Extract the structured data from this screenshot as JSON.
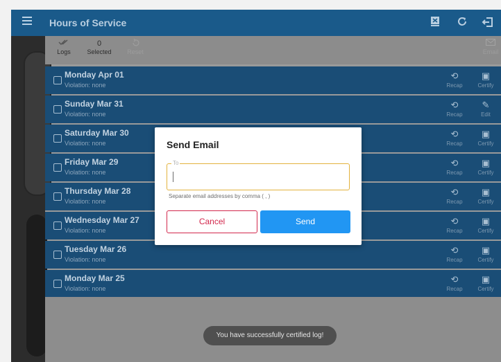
{
  "app": {
    "title": "Hours of Service"
  },
  "toolbar": {
    "logs_label": "Logs",
    "selected_count": "0",
    "selected_label": "Selected",
    "reset_label": "Reset",
    "email_label": "Email"
  },
  "logs": [
    {
      "day": "Monday Apr 01",
      "violation": "Violation: none",
      "recap": "Recap",
      "action": "Certify"
    },
    {
      "day": "Sunday Mar 31",
      "violation": "Violation: none",
      "recap": "Recap",
      "action": "Edit"
    },
    {
      "day": "Saturday Mar 30",
      "violation": "Violation: none",
      "recap": "Recap",
      "action": "Certify"
    },
    {
      "day": "Friday Mar 29",
      "violation": "Violation: none",
      "recap": "Recap",
      "action": "Certify"
    },
    {
      "day": "Thursday Mar 28",
      "violation": "Violation: none",
      "recap": "Recap",
      "action": "Certify"
    },
    {
      "day": "Wednesday Mar 27",
      "violation": "Violation: none",
      "recap": "Recap",
      "action": "Certify"
    },
    {
      "day": "Tuesday Mar 26",
      "violation": "Violation: none",
      "recap": "Recap",
      "action": "Certify"
    },
    {
      "day": "Monday Mar 25",
      "violation": "Violation: none",
      "recap": "Recap",
      "action": "Certify"
    }
  ],
  "dialog": {
    "title": "Send Email",
    "to_label": "To",
    "to_value": "",
    "hint": "Separate email addresses by comma ( , )",
    "cancel_label": "Cancel",
    "send_label": "Send"
  },
  "toast": "You have successfully certified log!",
  "colors": {
    "app_bar": "#1a5a8a",
    "row": "#1a4d76",
    "send_button": "#2196f3",
    "cancel_border": "#d2264b",
    "field_border": "#e3b23c"
  },
  "icons": {
    "menu": "hamburger-icon",
    "export": "export-icon",
    "refresh": "refresh-icon",
    "logout": "logout-icon",
    "logs": "double-check-icon",
    "reset": "undo-icon",
    "email": "envelope-icon",
    "recap": "history-icon",
    "certify": "certify-check-icon",
    "edit": "pencil-icon"
  }
}
